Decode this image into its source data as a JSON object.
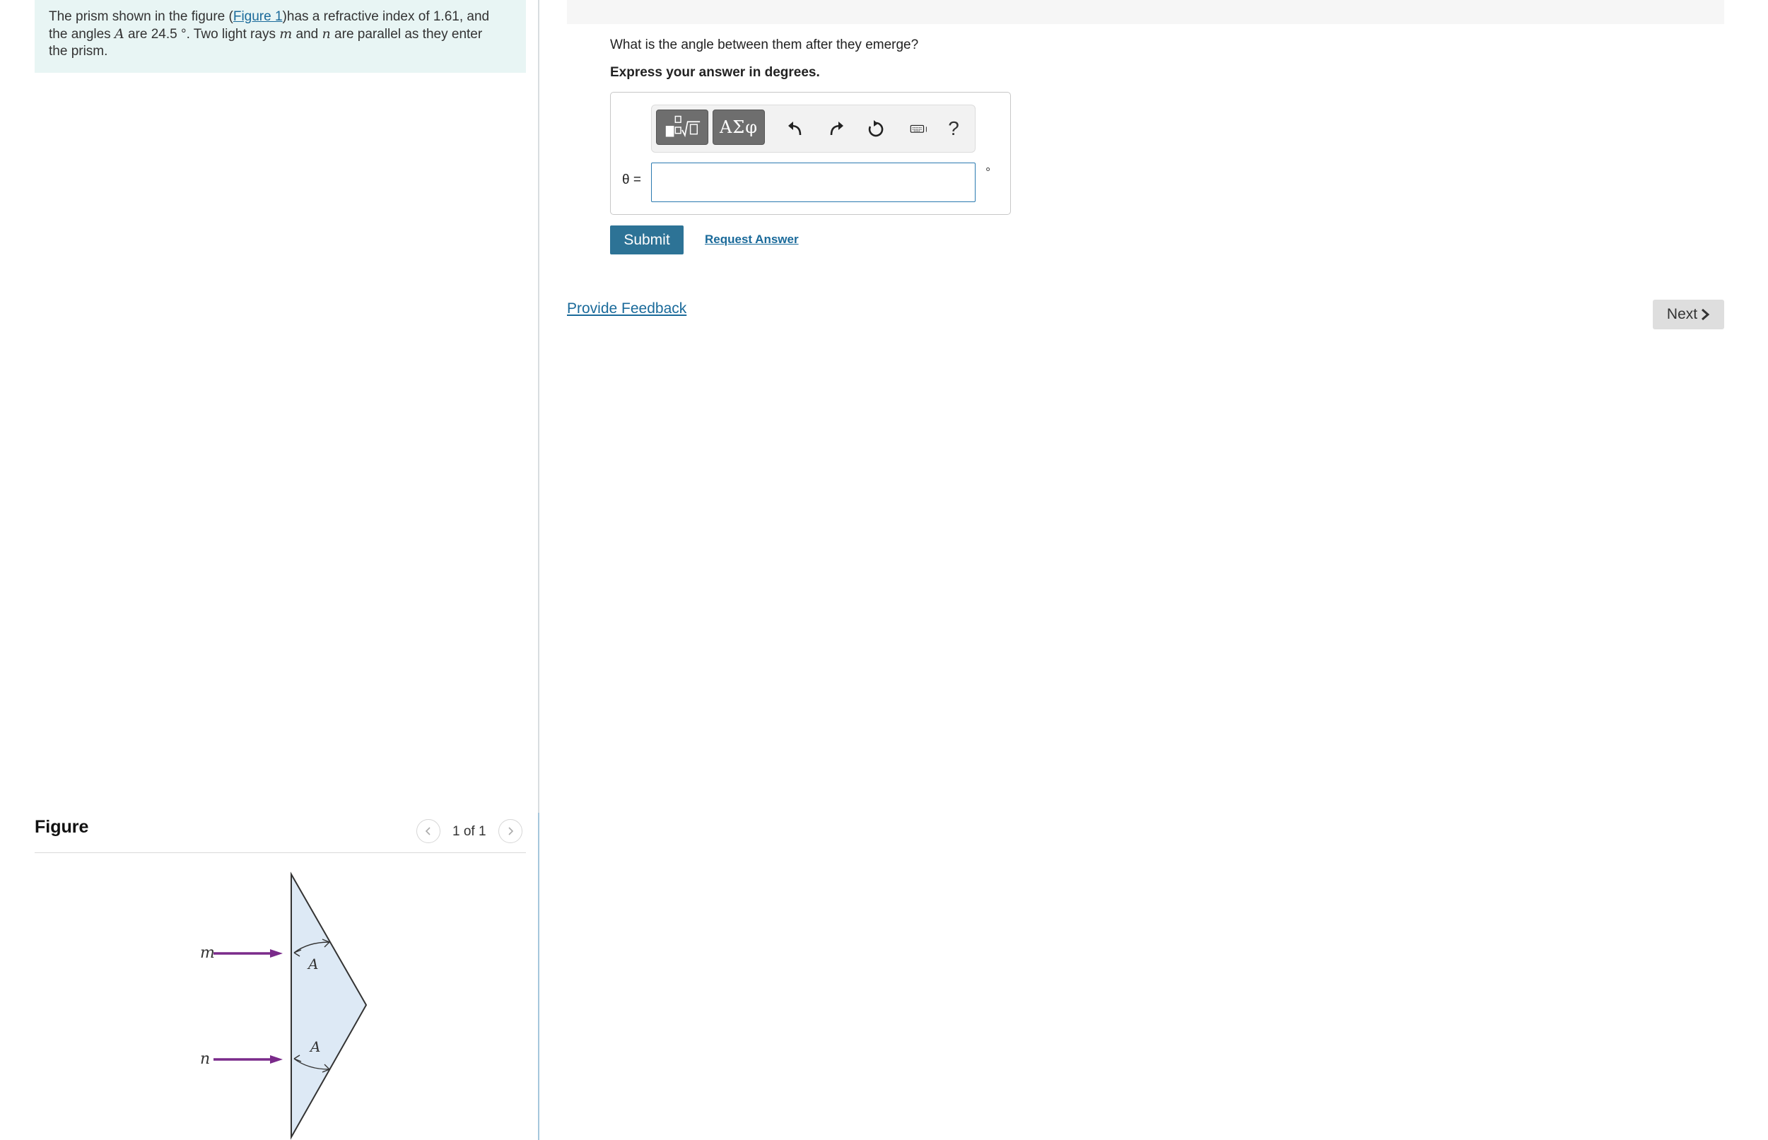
{
  "problem": {
    "text_before_link": "The prism shown in the figure (",
    "link_text": "Figure 1",
    "text_line1_after": ")has a refractive index of 1.61, and",
    "line2_pre": "the angles ",
    "var_A": "A",
    "line2_mid": " are 24.5 °. Two light rays ",
    "var_m": "m",
    "line2_and": " and ",
    "var_n": "n",
    "line2_post": " are parallel as they enter",
    "line3": "the prism."
  },
  "figure": {
    "title": "Figure",
    "counter": "1 of 1",
    "labels": {
      "m": "m",
      "n": "n",
      "A_top": "A",
      "A_bottom": "A"
    },
    "colors": {
      "prism_fill": "#dde9f5",
      "ray": "#7a2a8a"
    }
  },
  "question": {
    "prompt": "What is the angle between them after they emerge?",
    "instruction": "Express your answer in degrees."
  },
  "answer": {
    "label": "θ =",
    "value": "",
    "unit": "°",
    "toolbar": {
      "templates_icon": "fraction-sqrt-icon",
      "greek_label": "ΑΣφ",
      "undo_icon": "undo-icon",
      "redo_icon": "redo-icon",
      "reset_icon": "reset-icon",
      "keyboard_icon": "keyboard-icon",
      "help_label": "?"
    }
  },
  "actions": {
    "submit_label": "Submit",
    "request_answer_label": "Request Answer",
    "feedback_label": "Provide Feedback",
    "next_label": "Next"
  },
  "colors": {
    "accent": "#2d7396",
    "link": "#1a6a9a",
    "problem_bg": "#e8f5f4"
  }
}
